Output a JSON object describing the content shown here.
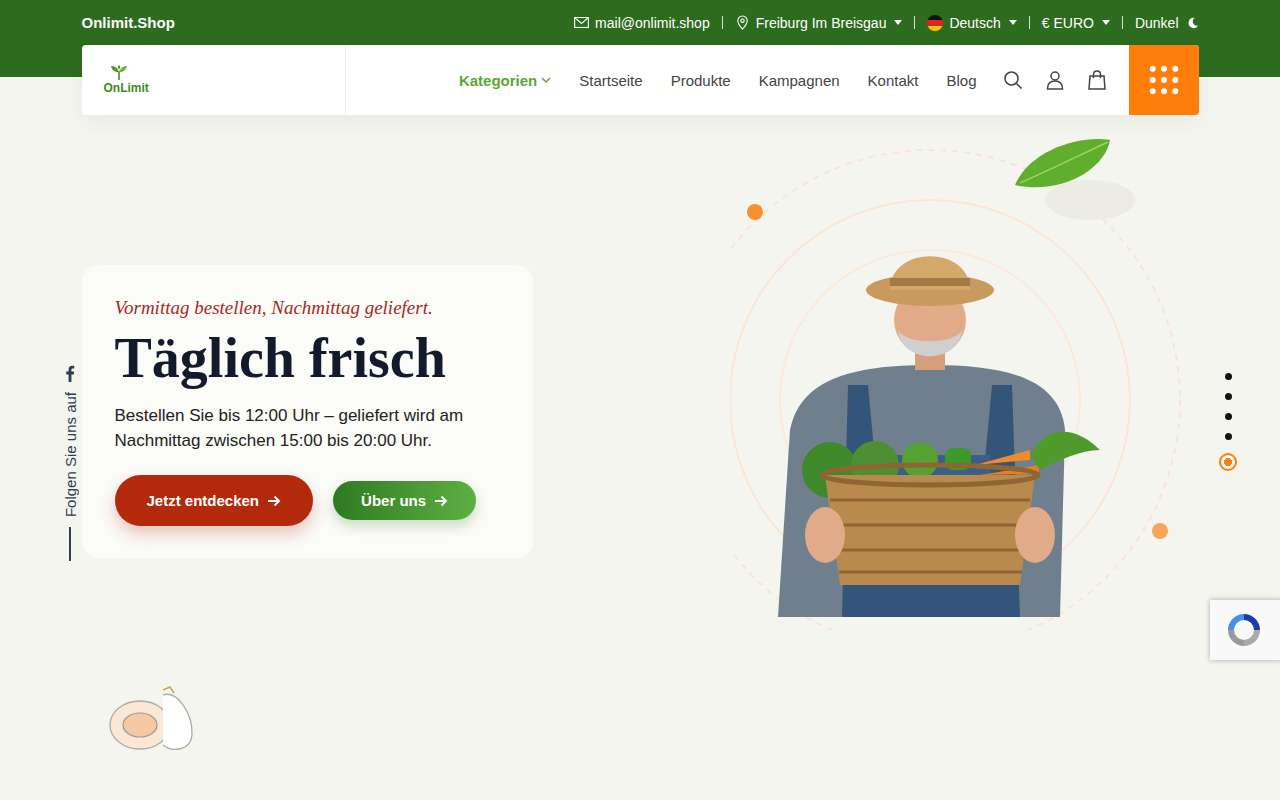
{
  "topbar": {
    "brand": "Onlimit.Shop",
    "email": {
      "label": "mail@onlimit.shop",
      "has_menu": false
    },
    "location": {
      "label": "Freiburg Im Breisgau",
      "has_menu": true
    },
    "language": {
      "label": "Deutsch",
      "has_menu": true
    },
    "currency": {
      "label": "€ EURO",
      "has_menu": true
    },
    "theme": {
      "label": "Dunkel",
      "has_menu": false
    }
  },
  "header": {
    "logo": "OnLimit",
    "nav": [
      {
        "label": "Kategorien",
        "selected": true,
        "has_menu": true
      },
      {
        "label": "Startseite",
        "selected": false,
        "has_menu": false
      },
      {
        "label": "Produkte",
        "selected": false,
        "has_menu": false
      },
      {
        "label": "Kampagnen",
        "selected": false,
        "has_menu": false
      },
      {
        "label": "Kontakt",
        "selected": false,
        "has_menu": false
      },
      {
        "label": "Blog",
        "selected": false,
        "has_menu": false
      }
    ]
  },
  "hero": {
    "tagline": "Vormittag bestellen, Nachmittag geliefert.",
    "title": "Täglich frisch",
    "text": "Bestellen Sie bis 12:00 Uhr – geliefert wird am Nachmittag zwischen 15:00 bis 20:00 Uhr.",
    "buttons": [
      {
        "label": "Jetzt entdecken",
        "kind": "primary"
      },
      {
        "label": "Über uns",
        "kind": "secondary"
      }
    ]
  },
  "social": {
    "label": "Folgen Sie uns auf"
  },
  "slides": [
    {
      "selected": false
    },
    {
      "selected": false
    },
    {
      "selected": false
    },
    {
      "selected": false
    },
    {
      "selected": true
    }
  ]
}
